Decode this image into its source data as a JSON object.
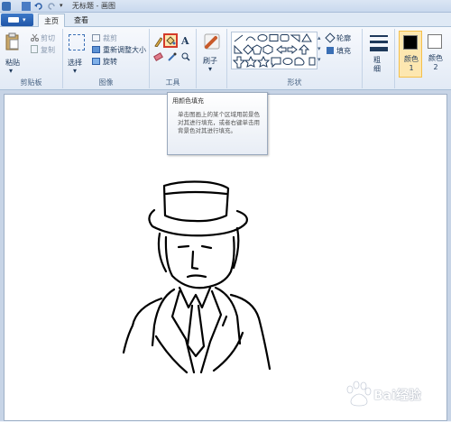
{
  "window": {
    "title": "无标题 - 画图"
  },
  "tabs": [
    {
      "label": "主页",
      "active": true
    },
    {
      "label": "查看",
      "active": false
    }
  ],
  "clipboard": {
    "paste": "粘贴",
    "cut": "剪切",
    "copy": "复制",
    "group": "剪贴板"
  },
  "image": {
    "select": "选择",
    "crop": "裁剪",
    "resize": "重新调整大小",
    "rotate": "旋转",
    "group": "图像"
  },
  "tools": {
    "group": "工具"
  },
  "brushes": {
    "label": "刷子"
  },
  "shapes": {
    "outline": "轮廓",
    "fill": "填充",
    "group": "形状"
  },
  "size": {
    "label": "粗细"
  },
  "colors": {
    "color1": "颜色 1",
    "color2": "颜色 2",
    "color1_value": "#000000",
    "color2_value": "#ffffff"
  },
  "tooltip": {
    "title": "用颜色填充",
    "desc": "单击图画上的某个区域用前景色对其进行填充，或者右键单击用背景色对其进行填充。"
  },
  "watermark": {
    "text": "Bai经验"
  },
  "accent": "#f5c04a"
}
